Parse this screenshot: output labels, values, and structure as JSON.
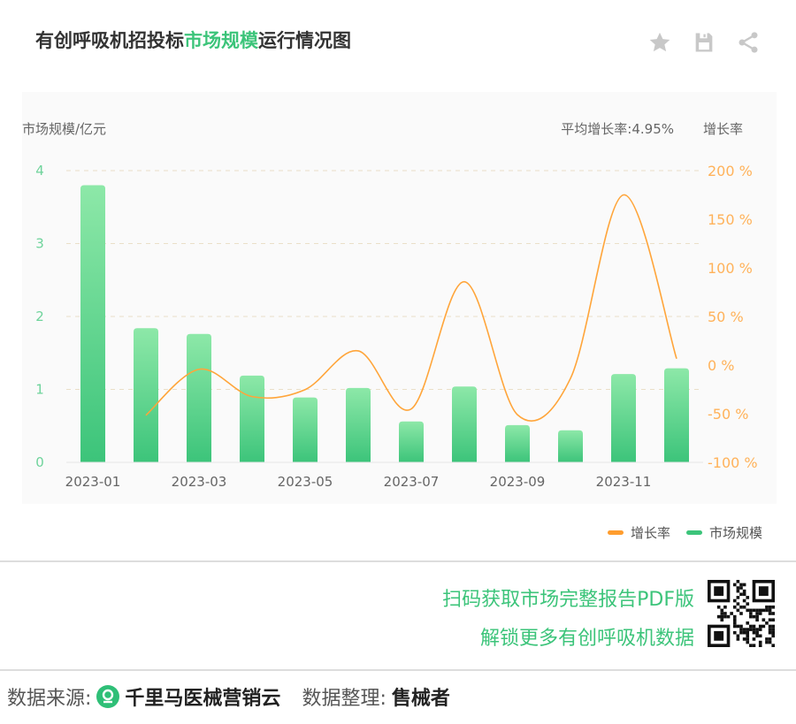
{
  "header": {
    "title_prefix": "有创呼吸机招投标",
    "title_highlight": "市场规模",
    "title_suffix": "运行情况图",
    "icons": [
      "star-icon",
      "save-icon",
      "share-icon"
    ]
  },
  "chart_data": {
    "type": "bar+line",
    "left_axis_label": "市场规模/亿元",
    "right_axis_label": "增长率",
    "avg_growth_text": "平均增长率:4.95%",
    "categories": [
      "2023-01",
      "2023-02",
      "2023-03",
      "2023-04",
      "2023-05",
      "2023-06",
      "2023-07",
      "2023-08",
      "2023-09",
      "2023-10",
      "2023-11",
      "2023-12"
    ],
    "x_tick_labels": [
      "2023-01",
      "2023-03",
      "2023-05",
      "2023-07",
      "2023-09",
      "2023-11"
    ],
    "y_left_ticks": [
      "0",
      "1",
      "2",
      "3",
      "4"
    ],
    "y_left_lim": [
      0,
      4
    ],
    "y_right_ticks": [
      "-100 %",
      "-50 %",
      "0 %",
      "50 %",
      "100 %",
      "150 %",
      "200 %"
    ],
    "y_right_lim": [
      -100,
      200
    ],
    "series": [
      {
        "name": "市场规模",
        "axis": "left",
        "type": "bar",
        "values": [
          3.8,
          1.84,
          1.76,
          1.19,
          0.89,
          1.02,
          0.56,
          1.04,
          0.51,
          0.44,
          1.21,
          1.29
        ]
      },
      {
        "name": "增长率",
        "axis": "right",
        "type": "line",
        "values": [
          null,
          -51.6,
          -4.3,
          -32.4,
          -25.2,
          14.6,
          -45.1,
          85.7,
          -51.0,
          -13.7,
          175.0,
          6.6
        ]
      }
    ],
    "legend": [
      {
        "name": "增长率",
        "color": "#ff9d2e"
      },
      {
        "name": "市场规模",
        "color": "#3cc47a"
      }
    ],
    "grid": true,
    "legend_position": "bottom-right"
  },
  "colors": {
    "accent": "#3cc47a",
    "line": "#ffa53a",
    "left_tick": "#6ed39b",
    "right_tick": "#ffb25a"
  },
  "promo": {
    "line1": "扫码获取市场完整报告PDF版",
    "line2": "解锁更多有创呼吸机数据"
  },
  "footer": {
    "source_label": "数据来源:",
    "source_name": "千里马医械营销云",
    "org_label": "数据整理:",
    "org_name": "售械者"
  }
}
